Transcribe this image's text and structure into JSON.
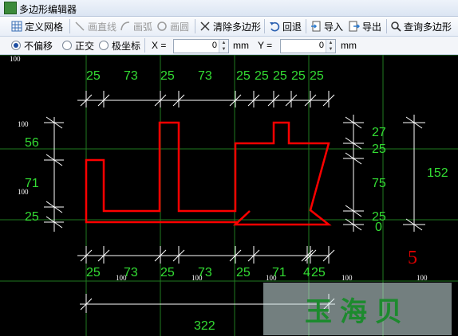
{
  "window": {
    "title": "多边形编辑器"
  },
  "toolbar": {
    "define_grid": "定义网格",
    "draw_line": "画直线",
    "draw_arc": "画弧",
    "draw_circle": "画圆",
    "clear_polygon": "清除多边形",
    "undo": "回退",
    "import": "导入",
    "export": "导出",
    "query": "查询多边形"
  },
  "options": {
    "no_offset": "不偏移",
    "orthogonal": "正交",
    "polar": "极坐标",
    "selected": "不偏移",
    "x_label": "X =",
    "x_value": "0",
    "x_unit": "mm",
    "y_label": "Y =",
    "y_value": "0",
    "y_unit": "mm"
  },
  "canvas": {
    "colors": {
      "background": "#000000",
      "polygon": "#ff0000",
      "dimension_text": "#33dd33",
      "dimension_line": "#ffffff",
      "grid": "#1f7a1f"
    },
    "top_dims": [
      "25",
      "73",
      "25",
      "73",
      "25",
      "25",
      "25",
      "25",
      "25"
    ],
    "bottom_dims": [
      "25",
      "73",
      "25",
      "73",
      "25",
      "71",
      "4",
      "25"
    ],
    "left_dims": [
      "56",
      "71",
      "25"
    ],
    "right_dims": [
      "27",
      "25",
      "75",
      "25",
      "0"
    ],
    "right_total": "152",
    "bottom_total": "322",
    "grid_labels": [
      "100",
      "100",
      "100",
      "100",
      "100",
      "100",
      "100",
      "100"
    ],
    "badge": "5"
  },
  "watermark": "玉海贝"
}
